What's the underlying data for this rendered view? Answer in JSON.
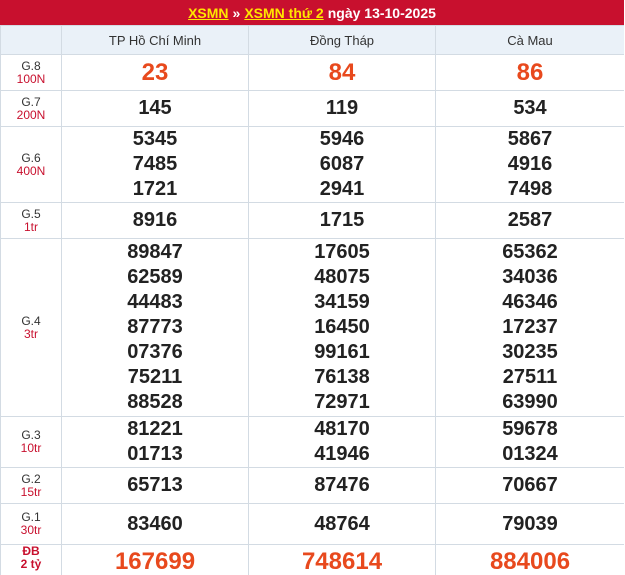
{
  "header": {
    "link1": "XSMN",
    "separator": "»",
    "link2": "XSMN thứ 2",
    "date_text": "ngày 13-10-2025"
  },
  "provinces": [
    "TP Hồ Chí Minh",
    "Đồng Tháp",
    "Cà Mau"
  ],
  "prizes": [
    {
      "name": "G.8",
      "amount": "100N",
      "cls": "r8",
      "style": "big",
      "values": [
        [
          "23"
        ],
        [
          "84"
        ],
        [
          "86"
        ]
      ]
    },
    {
      "name": "G.7",
      "amount": "200N",
      "cls": "r7",
      "style": "normal",
      "values": [
        [
          "145"
        ],
        [
          "119"
        ],
        [
          "534"
        ]
      ]
    },
    {
      "name": "G.6",
      "amount": "400N",
      "cls": "r6",
      "style": "normal",
      "values": [
        [
          "5345",
          "7485",
          "1721"
        ],
        [
          "5946",
          "6087",
          "2941"
        ],
        [
          "5867",
          "4916",
          "7498"
        ]
      ]
    },
    {
      "name": "G.5",
      "amount": "1tr",
      "cls": "r5",
      "style": "normal",
      "values": [
        [
          "8916"
        ],
        [
          "1715"
        ],
        [
          "2587"
        ]
      ]
    },
    {
      "name": "G.4",
      "amount": "3tr",
      "cls": "r4",
      "style": "normal",
      "values": [
        [
          "89847",
          "62589",
          "44483",
          "87773",
          "07376",
          "75211",
          "88528"
        ],
        [
          "17605",
          "48075",
          "34159",
          "16450",
          "99161",
          "76138",
          "72971"
        ],
        [
          "65362",
          "34036",
          "46346",
          "17237",
          "30235",
          "27511",
          "63990"
        ]
      ]
    },
    {
      "name": "G.3",
      "amount": "10tr",
      "cls": "r3",
      "style": "normal",
      "values": [
        [
          "81221",
          "01713"
        ],
        [
          "48170",
          "41946"
        ],
        [
          "59678",
          "01324"
        ]
      ]
    },
    {
      "name": "G.2",
      "amount": "15tr",
      "cls": "r2",
      "style": "normal",
      "values": [
        [
          "65713"
        ],
        [
          "87476"
        ],
        [
          "70667"
        ]
      ]
    },
    {
      "name": "G.1",
      "amount": "30tr",
      "cls": "r1",
      "style": "normal",
      "values": [
        [
          "83460"
        ],
        [
          "48764"
        ],
        [
          "79039"
        ]
      ]
    },
    {
      "name": "ĐB",
      "amount": "2 tỷ",
      "cls": "rdb",
      "style": "db",
      "values": [
        [
          "167699"
        ],
        [
          "748614"
        ],
        [
          "884006"
        ]
      ]
    }
  ],
  "colors": {
    "header_bg": "#c8102e",
    "header_link": "#ffe600",
    "highlight_number": "#e8491d",
    "table_header_bg": "#eaf1f8"
  }
}
